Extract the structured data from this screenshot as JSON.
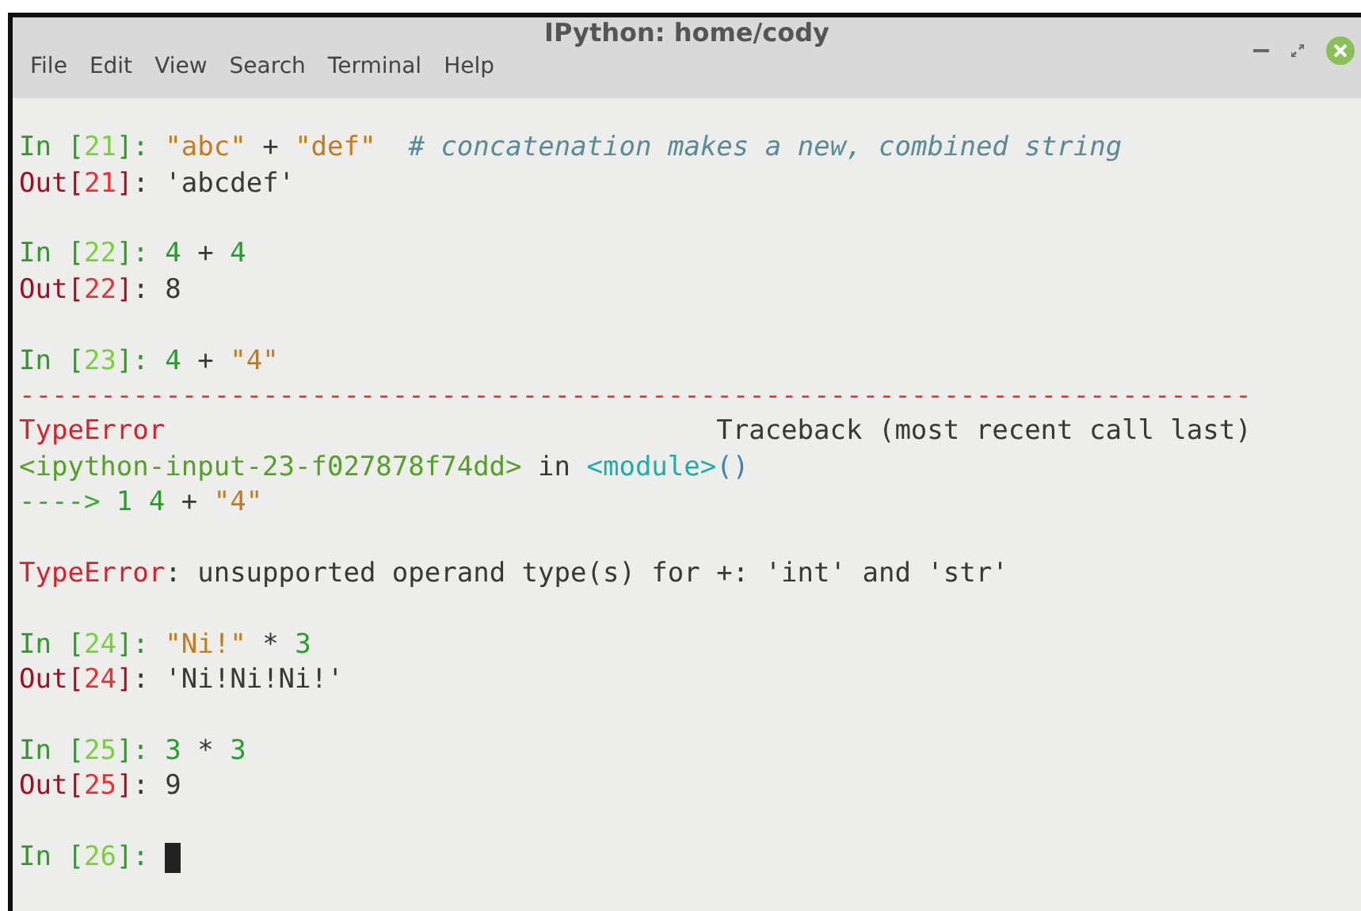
{
  "window": {
    "title": "IPython: home/cody"
  },
  "menu": [
    "File",
    "Edit",
    "View",
    "Search",
    "Terminal",
    "Help"
  ],
  "blocks": [
    {
      "lines": [
        {
          "cursor": false,
          "segments": [
            {
              "kind": "in_prompt",
              "text": "In ["
            },
            {
              "kind": "in_number",
              "text": "21"
            },
            {
              "kind": "in_prompt",
              "text": "]: "
            },
            {
              "kind": "string",
              "text": "\"abc\""
            },
            {
              "kind": "text",
              "text": " + "
            },
            {
              "kind": "string",
              "text": "\"def\""
            },
            {
              "kind": "comment",
              "text": "  # concatenation makes a new, combined string"
            }
          ]
        },
        {
          "cursor": false,
          "segments": [
            {
              "kind": "out_prompt",
              "text": "Out["
            },
            {
              "kind": "out_number",
              "text": "21"
            },
            {
              "kind": "out_prompt",
              "text": "]"
            },
            {
              "kind": "text",
              "text": ": 'abcdef'"
            }
          ]
        }
      ]
    },
    {
      "lines": [
        {
          "cursor": false,
          "segments": [
            {
              "kind": "in_prompt",
              "text": "In ["
            },
            {
              "kind": "in_number",
              "text": "22"
            },
            {
              "kind": "in_prompt",
              "text": "]: "
            },
            {
              "kind": "code",
              "text": "4"
            },
            {
              "kind": "text",
              "text": " + "
            },
            {
              "kind": "code",
              "text": "4"
            }
          ]
        },
        {
          "cursor": false,
          "segments": [
            {
              "kind": "out_prompt",
              "text": "Out["
            },
            {
              "kind": "out_number",
              "text": "22"
            },
            {
              "kind": "out_prompt",
              "text": "]"
            },
            {
              "kind": "text",
              "text": ": 8"
            }
          ]
        }
      ]
    },
    {
      "lines": [
        {
          "cursor": false,
          "segments": [
            {
              "kind": "in_prompt",
              "text": "In ["
            },
            {
              "kind": "in_number",
              "text": "23"
            },
            {
              "kind": "in_prompt",
              "text": "]: "
            },
            {
              "kind": "code",
              "text": "4"
            },
            {
              "kind": "text",
              "text": " + "
            },
            {
              "kind": "string",
              "text": "\"4\""
            }
          ]
        },
        {
          "cursor": false,
          "segments": [
            {
              "kind": "dashes",
              "text": "----------------------------------------------------------------------------"
            }
          ]
        },
        {
          "cursor": false,
          "segments": [
            {
              "kind": "error",
              "text": "TypeError"
            },
            {
              "kind": "text",
              "text": "                                  Traceback (most recent call last)"
            }
          ]
        },
        {
          "cursor": false,
          "segments": [
            {
              "kind": "file",
              "text": "<ipython-input-23-f027878f74dd>"
            },
            {
              "kind": "text",
              "text": " in "
            },
            {
              "kind": "module",
              "text": "<module>"
            },
            {
              "kind": "paren",
              "text": "()"
            }
          ]
        },
        {
          "cursor": false,
          "segments": [
            {
              "kind": "arrow",
              "text": "---->"
            },
            {
              "kind": "code",
              "text": " 1"
            },
            {
              "kind": "code",
              "text": " 4"
            },
            {
              "kind": "text",
              "text": " + "
            },
            {
              "kind": "string",
              "text": "\"4\""
            }
          ]
        }
      ]
    },
    {
      "lines": [
        {
          "cursor": false,
          "segments": [
            {
              "kind": "error",
              "text": "TypeError"
            },
            {
              "kind": "text",
              "text": ": unsupported operand type(s) for +: 'int' and 'str'"
            }
          ]
        }
      ]
    },
    {
      "lines": [
        {
          "cursor": false,
          "segments": [
            {
              "kind": "in_prompt",
              "text": "In ["
            },
            {
              "kind": "in_number",
              "text": "24"
            },
            {
              "kind": "in_prompt",
              "text": "]: "
            },
            {
              "kind": "string",
              "text": "\"Ni!\""
            },
            {
              "kind": "text",
              "text": " * "
            },
            {
              "kind": "code",
              "text": "3"
            }
          ]
        },
        {
          "cursor": false,
          "segments": [
            {
              "kind": "out_prompt",
              "text": "Out["
            },
            {
              "kind": "out_number",
              "text": "24"
            },
            {
              "kind": "out_prompt",
              "text": "]"
            },
            {
              "kind": "text",
              "text": ": 'Ni!Ni!Ni!'"
            }
          ]
        }
      ]
    },
    {
      "lines": [
        {
          "cursor": false,
          "segments": [
            {
              "kind": "in_prompt",
              "text": "In ["
            },
            {
              "kind": "in_number",
              "text": "25"
            },
            {
              "kind": "in_prompt",
              "text": "]: "
            },
            {
              "kind": "code",
              "text": "3"
            },
            {
              "kind": "text",
              "text": " * "
            },
            {
              "kind": "code",
              "text": "3"
            }
          ]
        },
        {
          "cursor": false,
          "segments": [
            {
              "kind": "out_prompt",
              "text": "Out["
            },
            {
              "kind": "out_number",
              "text": "25"
            },
            {
              "kind": "out_prompt",
              "text": "]"
            },
            {
              "kind": "text",
              "text": ": 9"
            }
          ]
        }
      ]
    },
    {
      "lines": [
        {
          "cursor": true,
          "segments": [
            {
              "kind": "in_prompt",
              "text": "In ["
            },
            {
              "kind": "in_number",
              "text": "26"
            },
            {
              "kind": "in_prompt",
              "text": "]: "
            }
          ]
        }
      ]
    }
  ]
}
